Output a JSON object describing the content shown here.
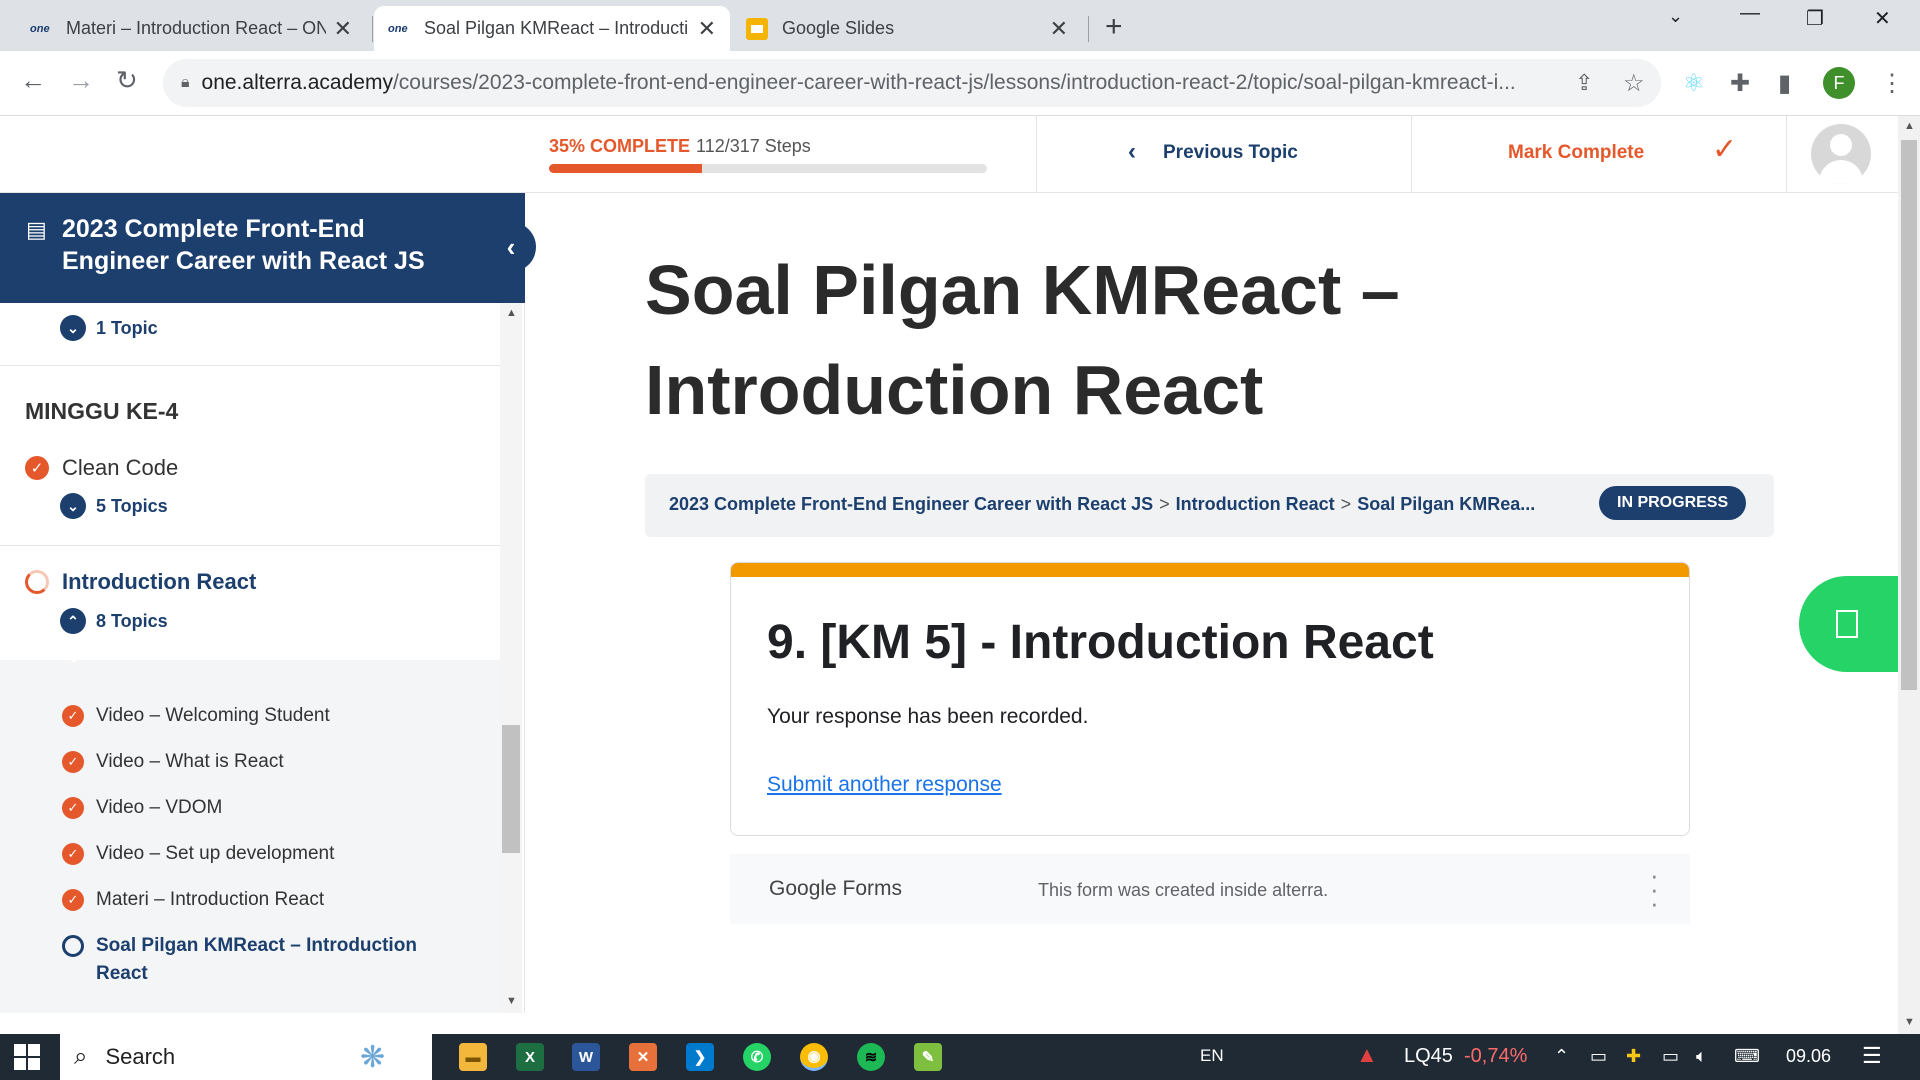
{
  "browser": {
    "tabs": [
      {
        "favicon": "one",
        "title": "Materi – Introduction React – ON"
      },
      {
        "favicon": "one",
        "title": "Soal Pilgan KMReact – Introducti"
      },
      {
        "favicon": "slides",
        "title": "Google Slides"
      }
    ],
    "url_host": "one.alterra.academy",
    "url_path": "/courses/2023-complete-front-end-engineer-career-with-react-js/lessons/introduction-react-2/topic/soal-pilgan-kmreact-i...",
    "profile_initial": "F"
  },
  "topbar": {
    "progress_percent_label": "35% COMPLETE",
    "progress_steps": "112/317 Steps",
    "progress_fraction": 0.35,
    "previous_topic": "Previous Topic",
    "mark_complete": "Mark Complete"
  },
  "sidebar": {
    "course_title": "2023 Complete Front-End Engineer Career with React JS",
    "top_topics": "1 Topic",
    "section": "MINGGU KE-4",
    "lessons": [
      {
        "title": "Clean Code",
        "topics": "5 Topics"
      },
      {
        "title": "Introduction React",
        "topics": "8 Topics"
      }
    ],
    "subtopics": [
      "Video – Welcoming Student",
      "Video – What is React",
      "Video – VDOM",
      "Video – Set up development",
      "Materi – Introduction React",
      "Soal Pilgan KMReact – Introduction React"
    ]
  },
  "main": {
    "title": "Soal Pilgan KMReact – Introduction React",
    "breadcrumb": [
      "2023 Complete Front-End Engineer Career with React JS",
      "Introduction React",
      "Soal Pilgan KMRea..."
    ],
    "status_badge": "IN PROGRESS",
    "form": {
      "title": "9. [KM 5] - Introduction React",
      "message": "Your response has been recorded.",
      "link": "Submit another response"
    },
    "gforms_logo": "Google Forms",
    "gforms_note": "This form was created inside alterra."
  },
  "taskbar": {
    "search_label": "Search",
    "language": "EN",
    "stock_name": "LQ45",
    "stock_change": "-0,74%",
    "time": "09.06"
  },
  "colors": {
    "brand_navy": "#1c3f6e",
    "accent_orange": "#e4582b",
    "form_bar": "#f29900"
  }
}
